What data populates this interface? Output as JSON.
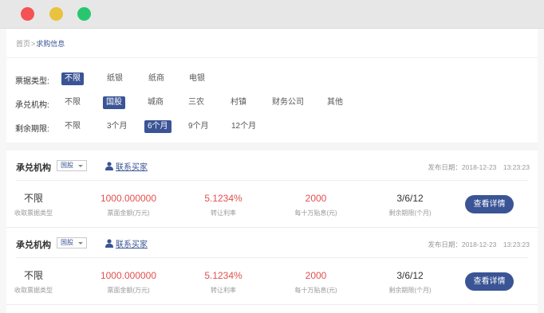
{
  "breadcrumb": {
    "home": "首页",
    "separator": ">",
    "current": "求购信息"
  },
  "filters": [
    {
      "label": "票据类型:",
      "options": [
        {
          "text": "不限",
          "active": true
        },
        {
          "text": "纸银",
          "active": false
        },
        {
          "text": "纸商",
          "active": false
        },
        {
          "text": "电银",
          "active": false
        }
      ]
    },
    {
      "label": "承兑机构:",
      "options": [
        {
          "text": "不限",
          "active": false
        },
        {
          "text": "国股",
          "active": true
        },
        {
          "text": "城商",
          "active": false
        },
        {
          "text": "三农",
          "active": false
        },
        {
          "text": "村镇",
          "active": false
        },
        {
          "text": "财务公司",
          "active": false
        },
        {
          "text": "其他",
          "active": false
        }
      ]
    },
    {
      "label": "剩余期限:",
      "options": [
        {
          "text": "不限",
          "active": false
        },
        {
          "text": "3个月",
          "active": false
        },
        {
          "text": "6个月",
          "active": true
        },
        {
          "text": "9个月",
          "active": false
        },
        {
          "text": "12个月",
          "active": false
        }
      ]
    }
  ],
  "cards": [
    {
      "institution_label": "承兑机构",
      "institution_value": "国股",
      "contact": "联系买家",
      "publish": "发布日期：2018-12-23　13:23:23",
      "stats": [
        {
          "value": "不限",
          "label": "收取票据类型",
          "tone": "dark"
        },
        {
          "value": "1000.000000",
          "label": "票面金额(万元)",
          "tone": "red"
        },
        {
          "value": "5.1234%",
          "label": "转让利率",
          "tone": "red"
        },
        {
          "value": "2000",
          "label": "每十万贴息(元)",
          "tone": "red"
        },
        {
          "value": "3/6/12",
          "label": "剩余期限(个月)",
          "tone": "dark"
        }
      ],
      "button": "查看详情"
    },
    {
      "institution_label": "承兑机构",
      "institution_value": "国股",
      "contact": "联系买家",
      "publish": "发布日期：2018-12-23　13:23:23",
      "stats": [
        {
          "value": "不限",
          "label": "收取票据类型",
          "tone": "dark"
        },
        {
          "value": "1000.000000",
          "label": "票面金额(万元)",
          "tone": "red"
        },
        {
          "value": "5.1234%",
          "label": "转让利率",
          "tone": "red"
        },
        {
          "value": "2000",
          "label": "每十万贴息(元)",
          "tone": "red"
        },
        {
          "value": "3/6/12",
          "label": "剩余期限(个月)",
          "tone": "dark"
        }
      ],
      "button": "查看详情"
    }
  ],
  "colors": {
    "accent": "#3a5495",
    "value_red": "#e24f4f",
    "dot_red": "#f45254",
    "dot_yellow": "#e9c23e",
    "dot_green": "#28c76f"
  }
}
